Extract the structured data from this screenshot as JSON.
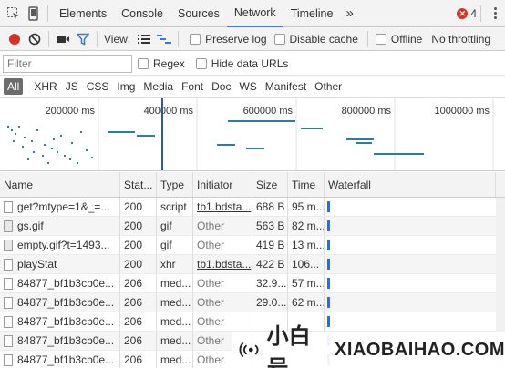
{
  "top_tabs": [
    "Elements",
    "Console",
    "Sources",
    "Network",
    "Timeline"
  ],
  "active_tab": "Network",
  "more_glyph": "»",
  "error_count": "4",
  "toolbar": {
    "view_label": "View:",
    "preserve_log": "Preserve log",
    "disable_cache": "Disable cache",
    "offline": "Offline",
    "throttle": "No throttling"
  },
  "filter": {
    "placeholder": "Filter",
    "regex": "Regex",
    "hide_data_urls": "Hide data URLs"
  },
  "types": [
    "All",
    "XHR",
    "JS",
    "CSS",
    "Img",
    "Media",
    "Font",
    "Doc",
    "WS",
    "Manifest",
    "Other"
  ],
  "overview": {
    "ticks": [
      "200000 ms",
      "400000 ms",
      "600000 ms",
      "800000 ms",
      "1000000 ms"
    ]
  },
  "columns": [
    "Name",
    "Stat...",
    "Type",
    "Initiator",
    "Size",
    "Time",
    "Waterfall"
  ],
  "rows": [
    {
      "name": "get?mtype=1&_=...",
      "status": "200",
      "type": "script",
      "initiator": "tb1.bdsta...",
      "initiator_link": true,
      "size": "688 B",
      "time": "95 m..."
    },
    {
      "name": "gs.gif",
      "status": "200",
      "type": "gif",
      "initiator": "Other",
      "initiator_link": false,
      "size": "563 B",
      "time": "82 m..."
    },
    {
      "name": "empty.gif?t=1493...",
      "status": "200",
      "type": "gif",
      "initiator": "Other",
      "initiator_link": false,
      "size": "419 B",
      "time": "13 m..."
    },
    {
      "name": "playStat",
      "status": "200",
      "type": "xhr",
      "initiator": "tb1.bdsta...",
      "initiator_link": true,
      "size": "422 B",
      "time": "106..."
    },
    {
      "name": "84877_bf1b3cb0e...",
      "status": "206",
      "type": "med...",
      "initiator": "Other",
      "initiator_link": false,
      "size": "32.9...",
      "time": "57 m..."
    },
    {
      "name": "84877_bf1b3cb0e...",
      "status": "206",
      "type": "med...",
      "initiator": "Other",
      "initiator_link": false,
      "size": "29.0...",
      "time": "62 m..."
    },
    {
      "name": "84877_bf1b3cb0e...",
      "status": "206",
      "type": "med...",
      "initiator": "Other",
      "initiator_link": false,
      "size": "",
      "time": ""
    },
    {
      "name": "84877_bf1b3cb0e...",
      "status": "206",
      "type": "med...",
      "initiator": "Other",
      "initiator_link": false,
      "size": "",
      "time": ""
    },
    {
      "name": "84877_bf1b3cb0e...",
      "status": "206",
      "type": "med...",
      "initiator": "Other",
      "initiator_link": false,
      "size": "",
      "time": ""
    }
  ],
  "watermark": {
    "cn": "小白号",
    "en": "XIAOBAIHAO.COM"
  },
  "colors": {
    "accent": "#3879d9",
    "record": "#d93026",
    "waterfall": "#1a73e8"
  }
}
